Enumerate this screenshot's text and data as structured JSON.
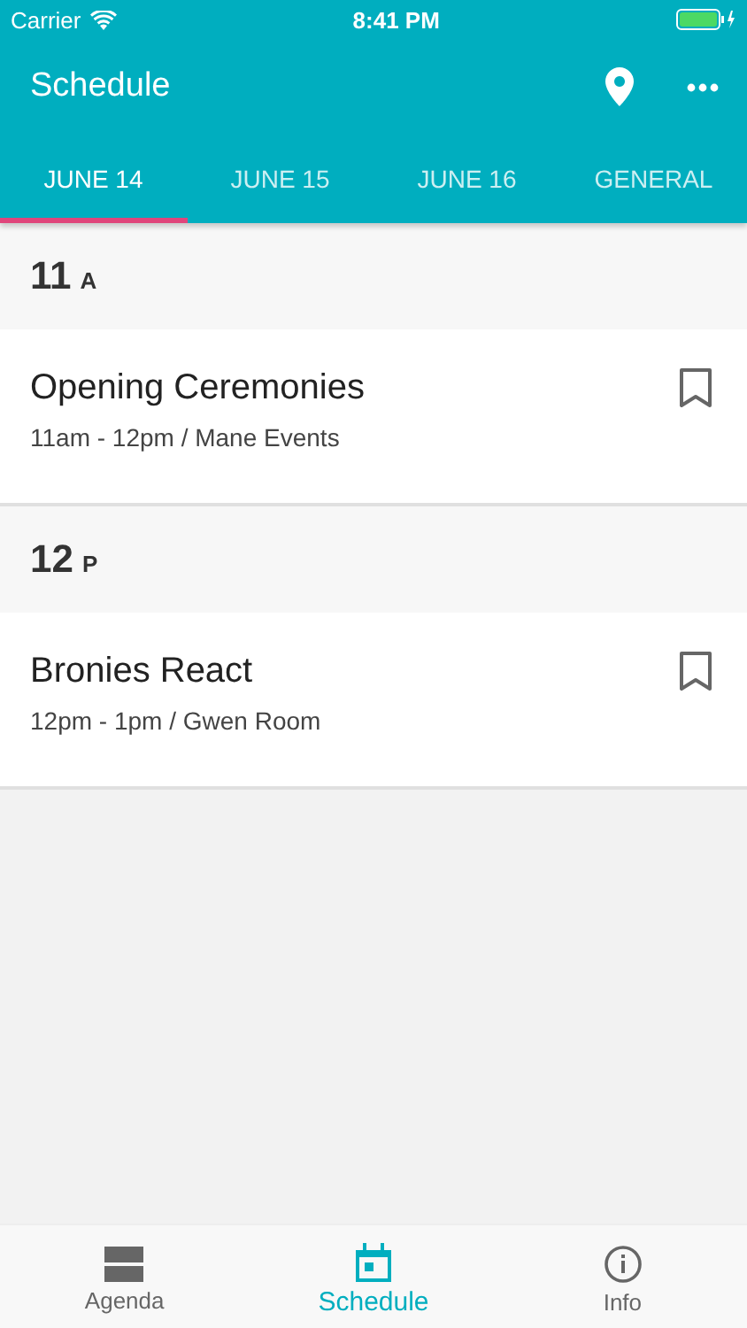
{
  "status_bar": {
    "carrier": "Carrier",
    "time": "8:41 PM"
  },
  "header": {
    "title": "Schedule"
  },
  "tabs": [
    {
      "label": "JUNE 14",
      "selected": true
    },
    {
      "label": "JUNE 15",
      "selected": false
    },
    {
      "label": "JUNE 16",
      "selected": false
    },
    {
      "label": "GENERAL",
      "selected": false
    }
  ],
  "sections": [
    {
      "hour": "11",
      "meridiem": "A",
      "events": [
        {
          "title": "Opening Ceremonies",
          "details": "11am - 12pm / Mane Events"
        }
      ]
    },
    {
      "hour": "12",
      "meridiem": "P",
      "events": [
        {
          "title": "Bronies React",
          "details": "12pm - 1pm / Gwen Room"
        }
      ]
    }
  ],
  "bottom_nav": [
    {
      "kind": "agenda",
      "label": "Agenda",
      "selected": false
    },
    {
      "kind": "schedule",
      "label": "Schedule",
      "selected": true
    },
    {
      "kind": "info",
      "label": "Info",
      "selected": false
    }
  ]
}
